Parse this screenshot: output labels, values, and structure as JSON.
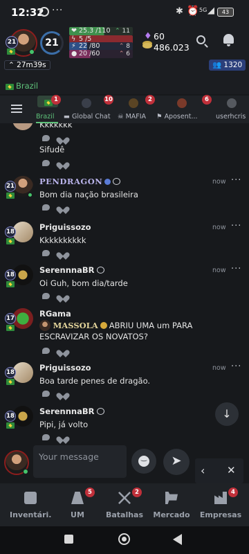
{
  "status_bar": {
    "time": "12:32",
    "more": "···",
    "battery": "43",
    "network": "5G"
  },
  "header": {
    "level": "21",
    "ring_level": "21",
    "bars": {
      "health": {
        "value": "25.3 /110",
        "regen": "11"
      },
      "energy": {
        "value": "5 /5"
      },
      "combat": {
        "value": "22 /80",
        "regen": "8"
      },
      "morale": {
        "value": "20 /60",
        "regen": "6"
      }
    },
    "gems": "60",
    "coins": "486.023",
    "timer": "27m39s",
    "players_online": "1320"
  },
  "channel": {
    "name": "Brazil"
  },
  "tabs": [
    {
      "label": "Brazil",
      "badge": "1"
    },
    {
      "label": "Global Chat",
      "badge": "10"
    },
    {
      "label": "MAFIA",
      "badge": "2"
    },
    {
      "label": "Aposent...",
      "badge": "6"
    },
    {
      "label": "userhcris"
    }
  ],
  "messages": [
    {
      "text1": "Kkkkkkk",
      "text2": "Sifudê"
    },
    {
      "level": "21",
      "name": "PENDRAGON",
      "time": "now",
      "text": "Bom dia nação brasileira"
    },
    {
      "level": "18",
      "name": "Priguissozo",
      "time": "now",
      "text": "Kkkkkkkkkk"
    },
    {
      "level": "18",
      "name": "SerennnaBR",
      "time": "now",
      "text": "Oi Guh, bom dia/tarde"
    },
    {
      "level": "17",
      "name": "RGama",
      "time": "now",
      "mention": "MASSOLA",
      "text": "ABRIU UMA um PARA ESCRAVIZAR OS NOVATOS?"
    },
    {
      "level": "18",
      "name": "Priguissozo",
      "time": "now",
      "text": "Boa tarde penes de dragão."
    },
    {
      "level": "18",
      "name": "SerennnaBR",
      "time": "",
      "text": "Pipi, já volto"
    }
  ],
  "composer": {
    "placeholder": "Your message",
    "prev": "‹",
    "close": "✕",
    "send": "➤",
    "scroll": "↓"
  },
  "bottom_nav": [
    {
      "label": "Inventári."
    },
    {
      "label": "UM",
      "badge": "5"
    },
    {
      "label": "Batalhas",
      "badge": "2"
    },
    {
      "label": "Mercado"
    },
    {
      "label": "Empresas",
      "badge": "4"
    }
  ],
  "colors": {
    "accent_green": "#5ec27a",
    "badge_red": "#c0303a",
    "background": "#17191c"
  }
}
